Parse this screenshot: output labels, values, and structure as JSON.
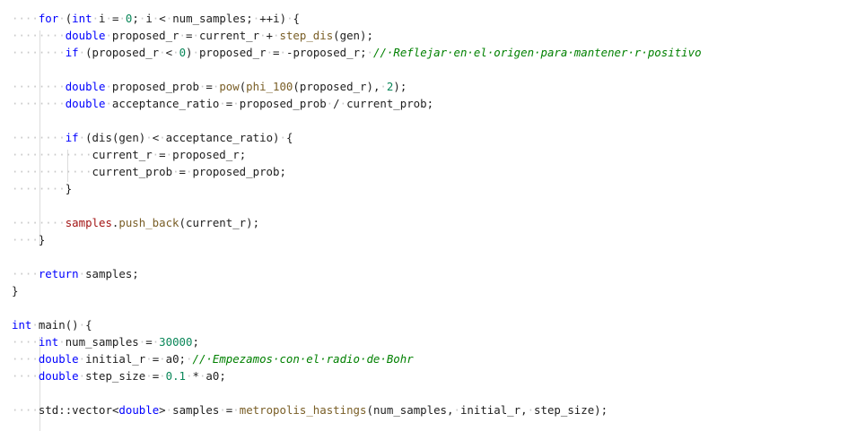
{
  "editor": {
    "language": "cpp",
    "colors": {
      "background": "#ffffff",
      "keyword": "#0000ff",
      "function": "#795e26",
      "number": "#098658",
      "comment": "#008000",
      "text": "#1e1e1e",
      "whitespace_marker": "#c8c8c8"
    },
    "lines": [
      "    for (int i = 0; i < num_samples; ++i) {",
      "        double proposed_r = current_r + step_dis(gen);",
      "        if (proposed_r < 0) proposed_r = -proposed_r; // Reflejar en el origen para mantener r positivo",
      "",
      "        double proposed_prob = pow(phi_100(proposed_r), 2);",
      "        double acceptance_ratio = proposed_prob / current_prob;",
      "",
      "        if (dis(gen) < acceptance_ratio) {",
      "            current_r = proposed_r;",
      "            current_prob = proposed_prob;",
      "        }",
      "",
      "        samples.push_back(current_r);",
      "    }",
      "",
      "    return samples;",
      "}",
      "",
      "int main() {",
      "    int num_samples = 30000;",
      "    double initial_r = a0; // Empezamos con el radio de Bohr",
      "    double step_size = 0.1 * a0;",
      "",
      "    std::vector<double> samples = metropolis_hastings(num_samples, initial_r, step_size);"
    ]
  }
}
